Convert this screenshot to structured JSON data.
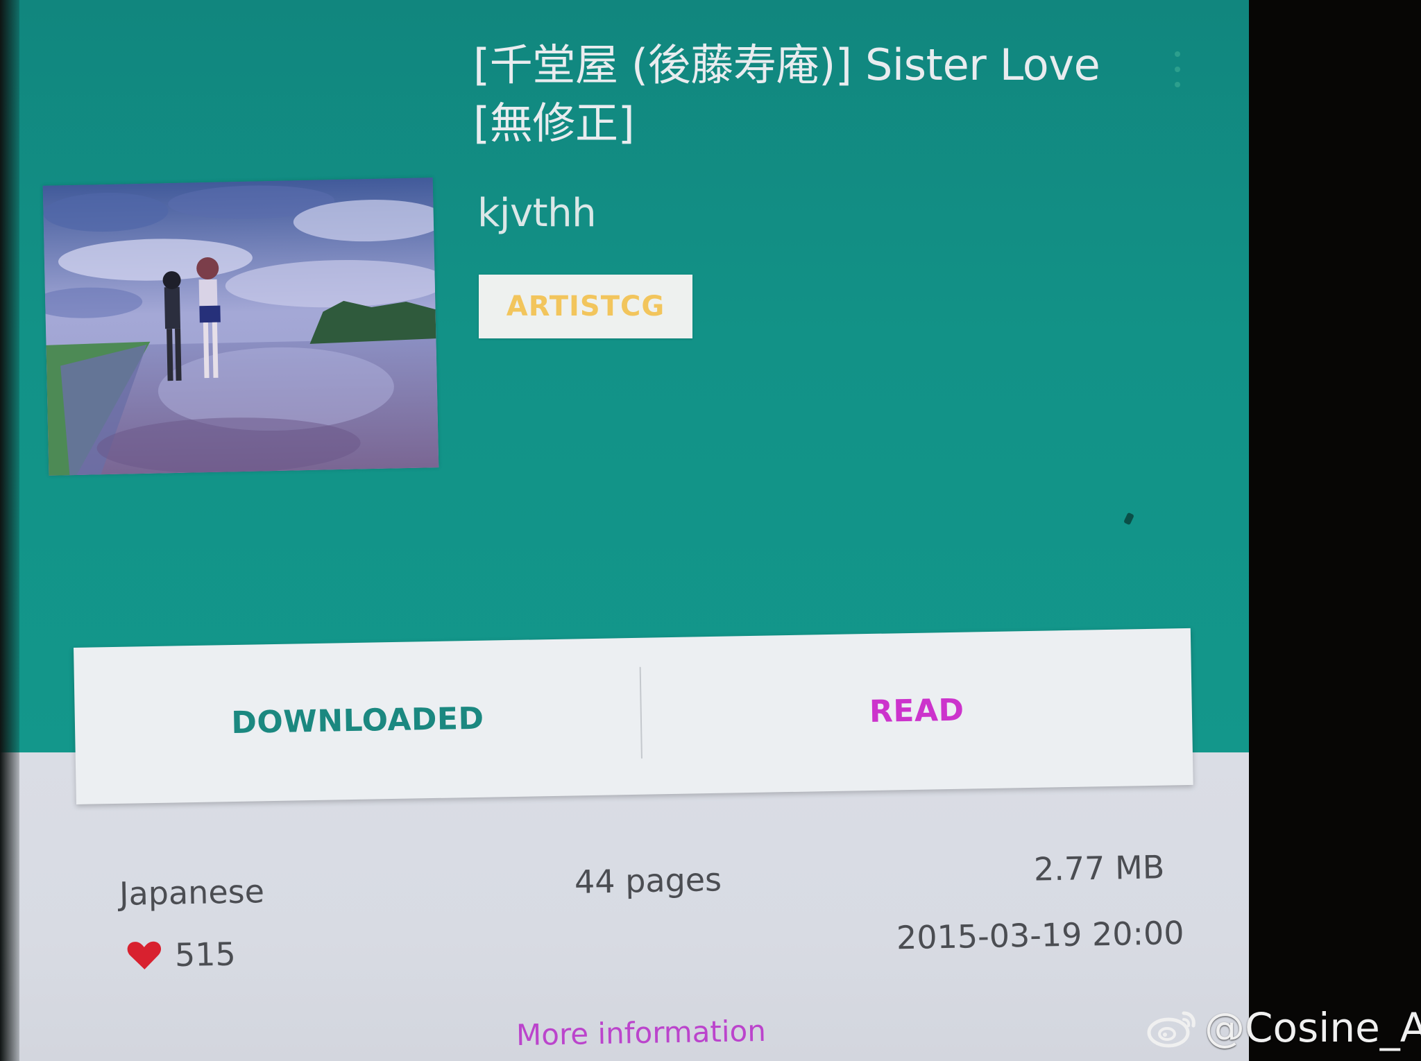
{
  "gallery": {
    "title": "[千堂屋 (後藤寿庵)] Sister Love [無修正]",
    "uploader": "kjvthh",
    "category": "ARTISTCG"
  },
  "actions": {
    "downloaded_label": "DOWNLOADED",
    "read_label": "READ"
  },
  "info": {
    "language": "Japanese",
    "pages": "44 pages",
    "size": "2.77 MB",
    "favorites": "515",
    "posted": "2015-03-19 20:00",
    "more_label": "More information"
  },
  "watermark": {
    "text": "@Cosine_A"
  },
  "icons": {
    "menu": "more-vert-icon",
    "favorite": "heart-icon",
    "watermark_logo": "weibo-icon"
  },
  "colors": {
    "header": "#139087",
    "downloaded": "#1b8880",
    "read": "#cc33cc",
    "category": "#f2c55c",
    "heart": "#d8212f"
  }
}
